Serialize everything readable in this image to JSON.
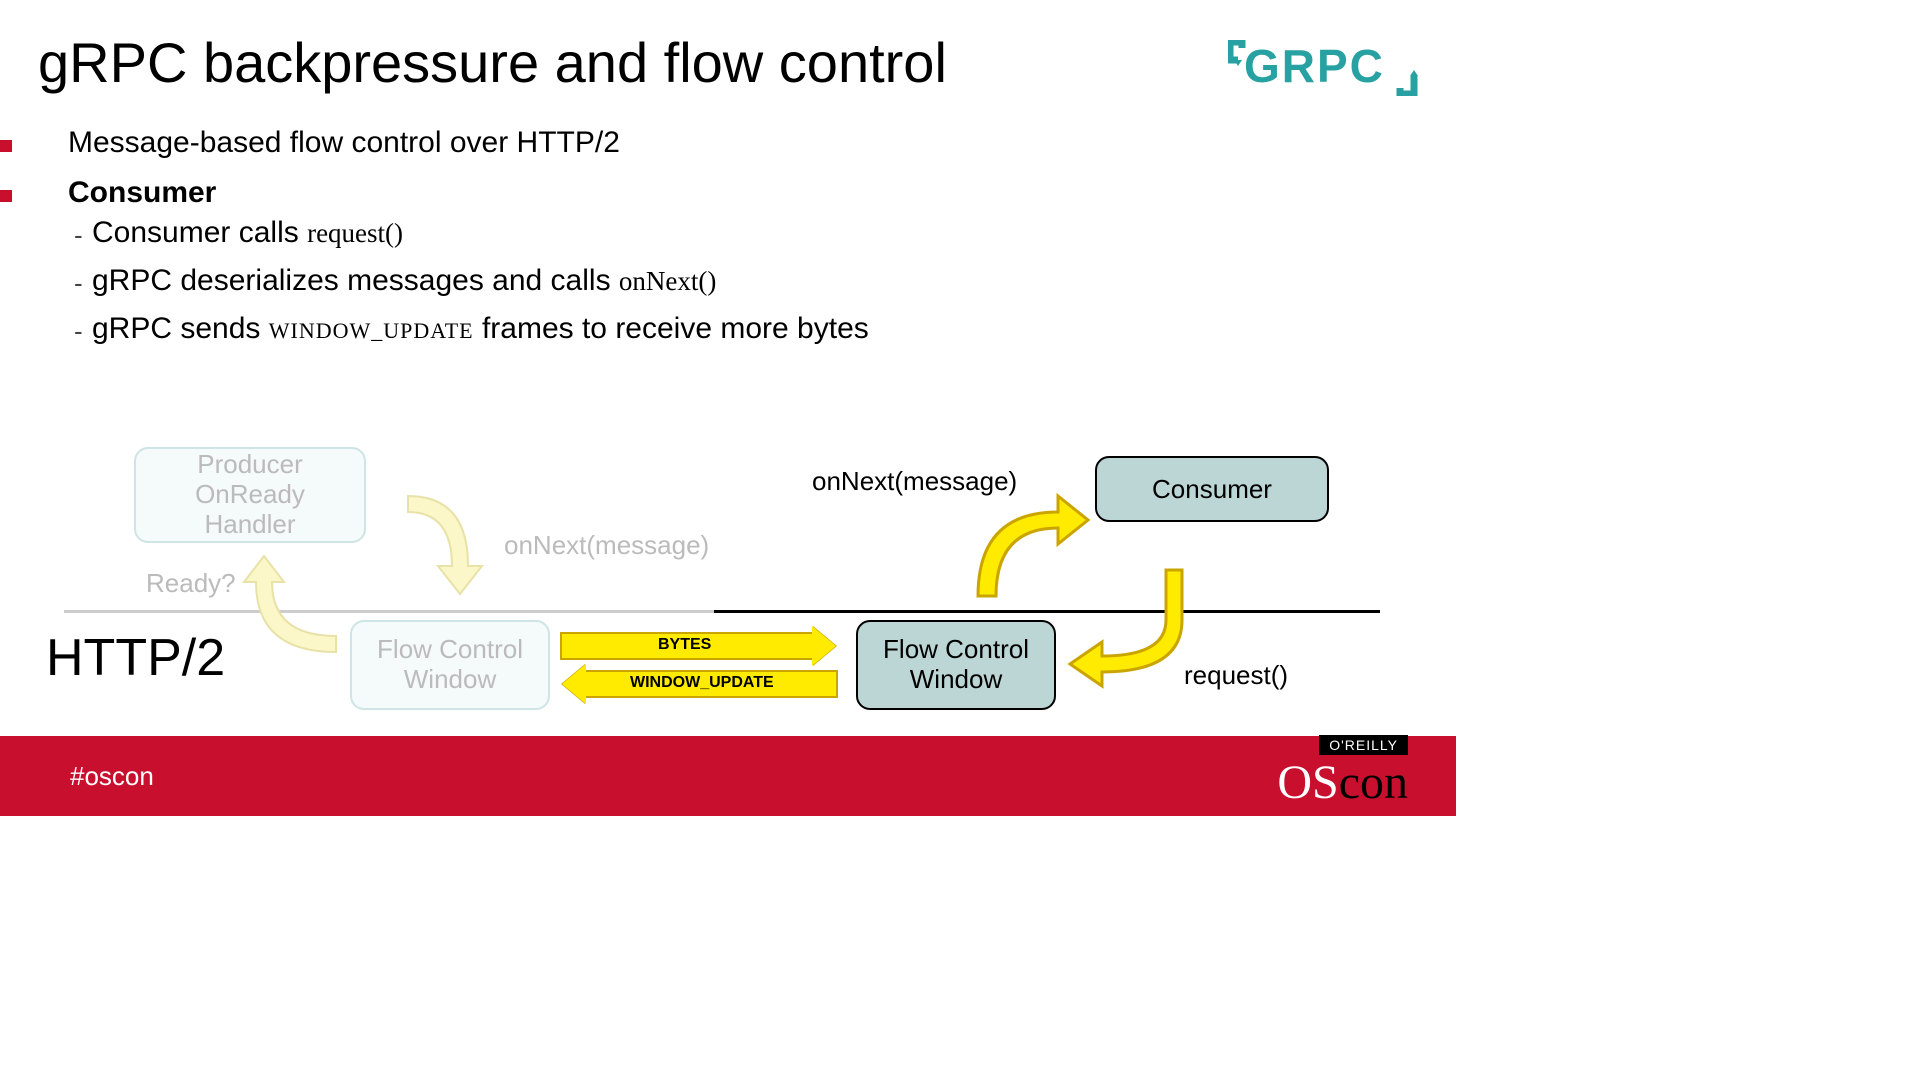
{
  "title": "gRPC backpressure and flow control",
  "logo": "GRPC",
  "bullets": {
    "b1": "Message-based flow control over HTTP/2",
    "b2": "Consumer",
    "s1a": "Consumer calls ",
    "s1b": "request()",
    "s2a": "gRPC deserializes messages and calls ",
    "s2b": "onNext()",
    "s3a": "gRPC sends ",
    "s3b": "WINDOW_UPDATE",
    "s3c": " frames to receive more bytes"
  },
  "diagram": {
    "http2": "HTTP/2",
    "producer": "Producer\nOnReady\nHandler",
    "ready": "Ready?",
    "onNextFaded": "onNext(message)",
    "fcwLeft": "Flow Control\nWindow",
    "bytes": "BYTES",
    "window_update": "WINDOW_UPDATE",
    "fcwRight": "Flow Control\nWindow",
    "onNextRight": "onNext(message)",
    "consumer": "Consumer",
    "request": "request()"
  },
  "footer": {
    "hashtag": "#oscon",
    "oreilly": "O'REILLY",
    "os": "OS",
    "con": "con"
  },
  "colors": {
    "accent": "#27A1A1",
    "brand": "#C8102E",
    "arrow": "#FFEB00"
  }
}
